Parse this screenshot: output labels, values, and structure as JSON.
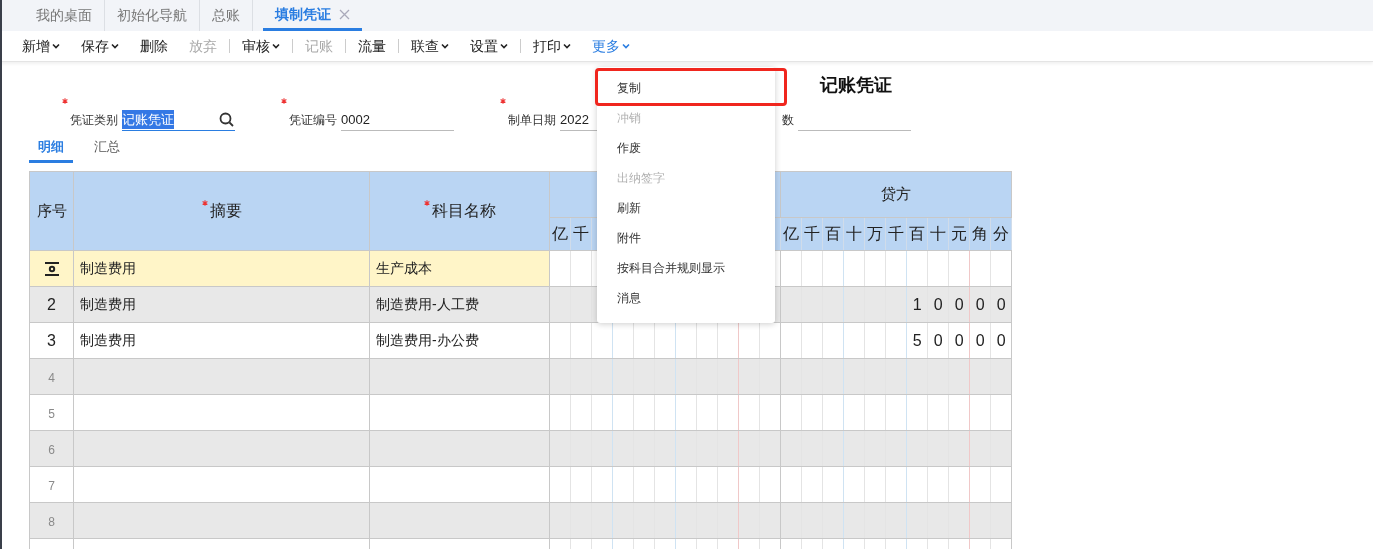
{
  "tabs": [
    {
      "label": "我的桌面",
      "selected": false
    },
    {
      "label": "初始化导航",
      "selected": false
    },
    {
      "label": "总账",
      "selected": false
    },
    {
      "label": "填制凭证",
      "selected": true
    }
  ],
  "toolbar": [
    {
      "kind": "button",
      "label": "新增",
      "dropdown": true,
      "disabled": false,
      "active": false
    },
    {
      "kind": "button",
      "label": "保存",
      "dropdown": true,
      "disabled": false,
      "active": false
    },
    {
      "kind": "button",
      "label": "删除",
      "dropdown": false,
      "disabled": false,
      "active": false
    },
    {
      "kind": "button",
      "label": "放弃",
      "dropdown": false,
      "disabled": true,
      "active": false
    },
    {
      "kind": "separator"
    },
    {
      "kind": "button",
      "label": "审核",
      "dropdown": true,
      "disabled": false,
      "active": false
    },
    {
      "kind": "separator"
    },
    {
      "kind": "button",
      "label": "记账",
      "dropdown": false,
      "disabled": true,
      "active": false
    },
    {
      "kind": "separator"
    },
    {
      "kind": "button",
      "label": "流量",
      "dropdown": false,
      "disabled": false,
      "active": false
    },
    {
      "kind": "separator"
    },
    {
      "kind": "button",
      "label": "联查",
      "dropdown": true,
      "disabled": false,
      "active": false
    },
    {
      "kind": "button",
      "label": "设置",
      "dropdown": true,
      "disabled": false,
      "active": false
    },
    {
      "kind": "separator"
    },
    {
      "kind": "button",
      "label": "打印",
      "dropdown": true,
      "disabled": false,
      "active": false
    },
    {
      "kind": "button",
      "label": "更多",
      "dropdown": true,
      "disabled": false,
      "active": true
    }
  ],
  "menu": {
    "items": [
      {
        "label": "复制",
        "disabled": false,
        "highlighted": true
      },
      {
        "label": "冲销",
        "disabled": true,
        "highlighted": false
      },
      {
        "label": "作废",
        "disabled": false,
        "highlighted": false
      },
      {
        "label": "出纳签字",
        "disabled": true,
        "highlighted": false
      },
      {
        "label": "刷新",
        "disabled": false,
        "highlighted": false
      },
      {
        "label": "附件",
        "disabled": false,
        "highlighted": false
      },
      {
        "label": "按科目合并规则显示",
        "disabled": false,
        "highlighted": false
      },
      {
        "label": "消息",
        "disabled": false,
        "highlighted": false
      }
    ]
  },
  "title": "记账凭证",
  "form": [
    {
      "label": "凭证类别",
      "required": true,
      "value": "记账凭证",
      "value_selected": true,
      "kind": "lookup"
    },
    {
      "label": "凭证编号",
      "required": true,
      "value": "0002",
      "value_selected": false,
      "kind": "text"
    },
    {
      "label": "制单日期",
      "required": true,
      "value": "2022",
      "value_selected": false,
      "kind": "text"
    },
    {
      "label": "数",
      "required": false,
      "value_selected": false,
      "kind": "text"
    }
  ],
  "subtabs": [
    {
      "label": "明细",
      "selected": true
    },
    {
      "label": "汇总",
      "selected": false
    }
  ],
  "table": {
    "columns": [
      {
        "label": "序号",
        "required": false
      },
      {
        "label": "摘要",
        "required": true
      },
      {
        "label": "科目名称",
        "required": true
      }
    ],
    "debit_units": [
      "亿",
      "千"
    ],
    "credit": {
      "label": "贷方",
      "units": [
        "亿",
        "千",
        "百",
        "十",
        "万",
        "千",
        "百",
        "十",
        "元",
        "角",
        "分"
      ]
    },
    "rows": [
      {
        "selected": true,
        "summary": "制造费用",
        "account": "生产成本"
      },
      {
        "seq": "2",
        "selected": false,
        "summary": "制造费用",
        "account": "制造费用-人工费",
        "credit": [
          "1",
          "0",
          "0",
          "0",
          "0"
        ]
      },
      {
        "seq": "3",
        "selected": false,
        "summary": "制造费用",
        "account": "制造费用-办公费",
        "credit": [
          "5",
          "0",
          "0",
          "0",
          "0"
        ]
      },
      {
        "seq": "4",
        "selected": false
      },
      {
        "seq": "5",
        "selected": false
      },
      {
        "seq": "6",
        "selected": false
      },
      {
        "seq": "7",
        "selected": false
      },
      {
        "seq": "8",
        "selected": false
      }
    ]
  }
}
